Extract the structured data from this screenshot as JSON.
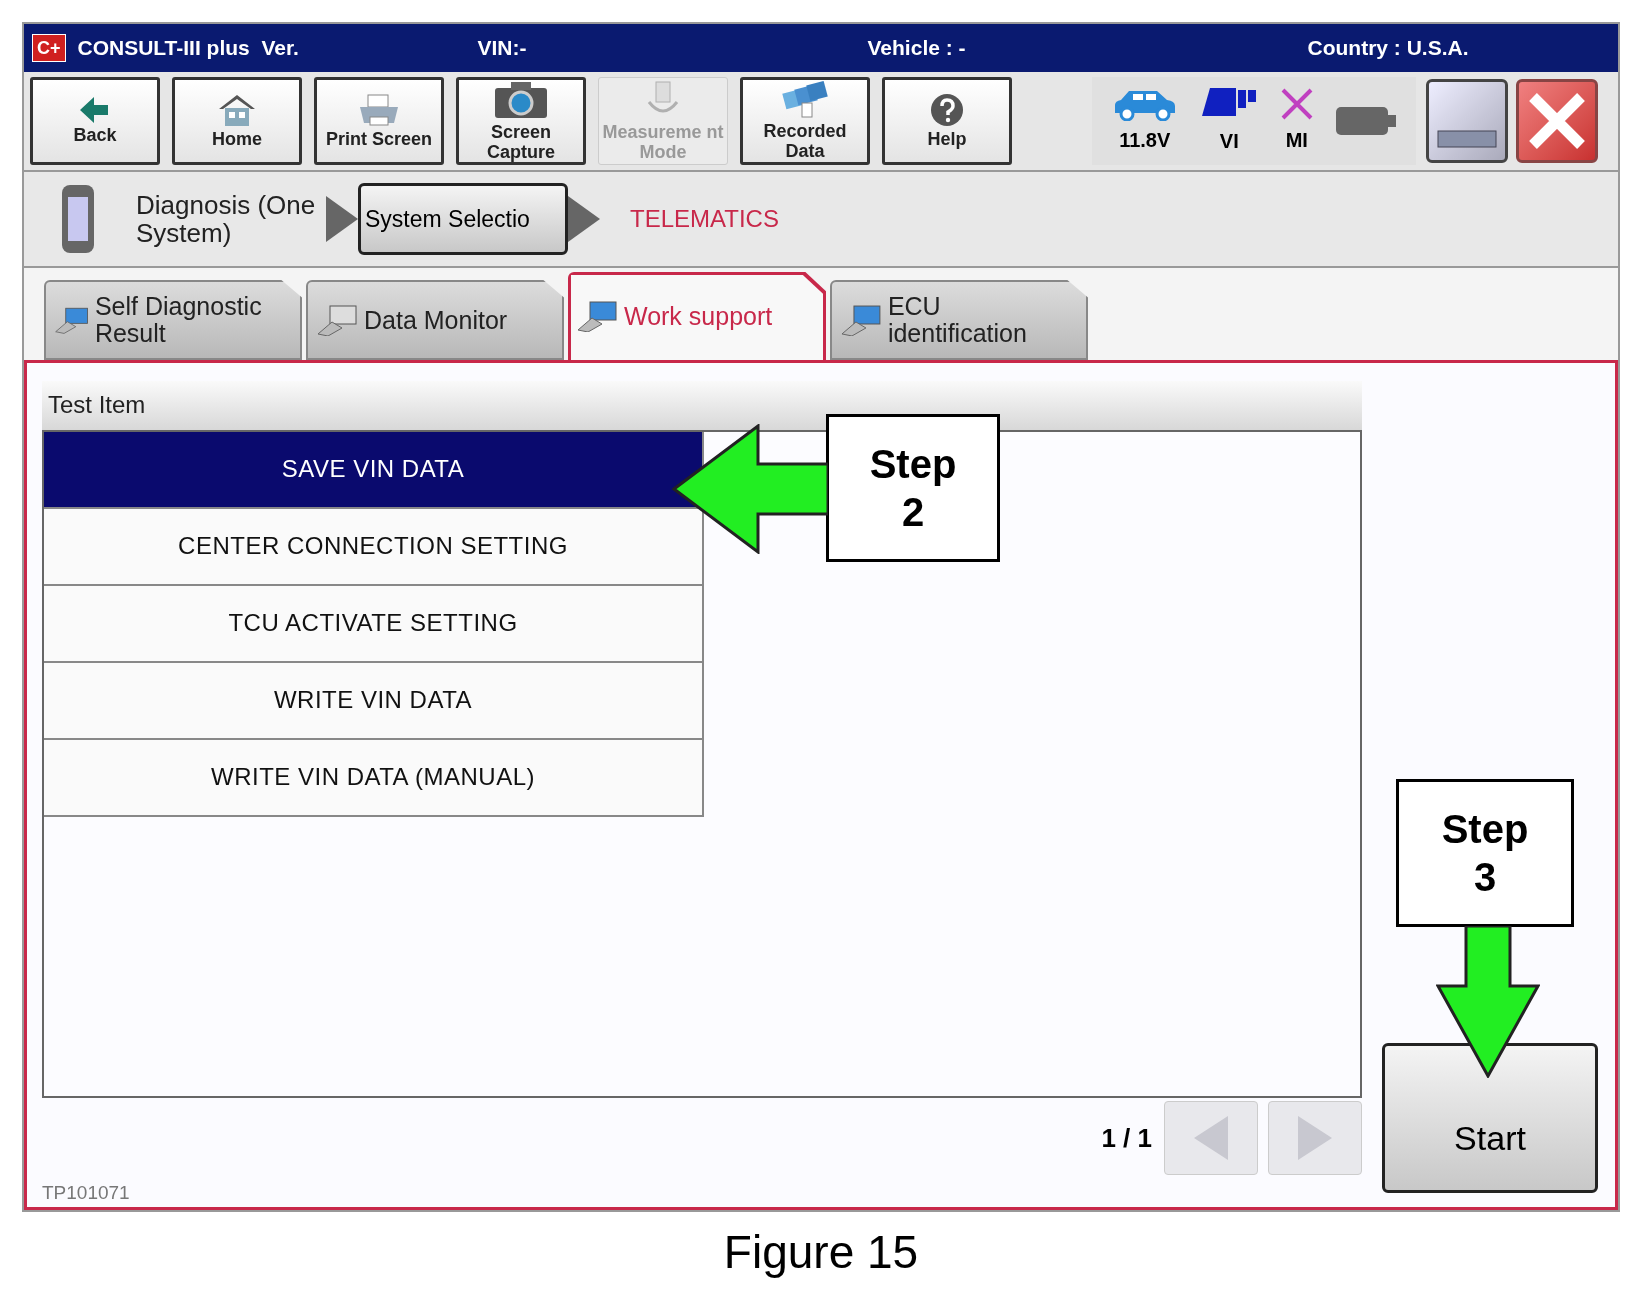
{
  "title_bar": {
    "logo": "C+",
    "app": "CONSULT-III plus  Ver.",
    "vin": "VIN:-",
    "vehicle": "Vehicle : -",
    "country": "Country : U.S.A."
  },
  "toolbar": [
    {
      "kind": "back",
      "label": "Back",
      "disabled": false
    },
    {
      "kind": "home",
      "label": "Home",
      "disabled": false
    },
    {
      "kind": "print",
      "label": "Print Screen",
      "disabled": false
    },
    {
      "kind": "camera",
      "label": "Screen Capture",
      "disabled": false
    },
    {
      "kind": "measure",
      "label": "Measureme nt Mode",
      "disabled": true
    },
    {
      "kind": "recorded",
      "label": "Recorded Data",
      "disabled": false
    },
    {
      "kind": "help",
      "label": "Help",
      "disabled": false
    }
  ],
  "status": [
    {
      "kind": "car",
      "label": "11.8V"
    },
    {
      "kind": "vi",
      "label": "VI"
    },
    {
      "kind": "mi",
      "label": "MI"
    },
    {
      "kind": "battery"
    }
  ],
  "breadcrumb": {
    "step1": "Diagnosis (One System)",
    "step2": "System Selectio",
    "current": "TELEMATICS"
  },
  "tabs": [
    {
      "label": "Self Diagnostic Result",
      "selected": false
    },
    {
      "label": "Data Monitor",
      "selected": false
    },
    {
      "label": "Work support",
      "selected": true
    },
    {
      "label": "ECU identification",
      "selected": false
    }
  ],
  "test_items": {
    "header": "Test Item",
    "rows": [
      {
        "label": "SAVE VIN DATA",
        "selected": true
      },
      {
        "label": "CENTER CONNECTION SETTING",
        "selected": false
      },
      {
        "label": "TCU ACTIVATE SETTING",
        "selected": false
      },
      {
        "label": "WRITE VIN DATA",
        "selected": false
      },
      {
        "label": "WRITE VIN DATA (MANUAL)",
        "selected": false
      }
    ]
  },
  "pager": {
    "page": "1 / 1",
    "prev_disabled": true,
    "next_disabled": true
  },
  "start_button": "Start",
  "callouts": [
    {
      "kind": "left",
      "lines": [
        "Step",
        "2"
      ]
    },
    {
      "kind": "down",
      "lines": [
        "Step",
        "3"
      ]
    }
  ],
  "doc_id": "TP101071",
  "caption": "Figure 15"
}
